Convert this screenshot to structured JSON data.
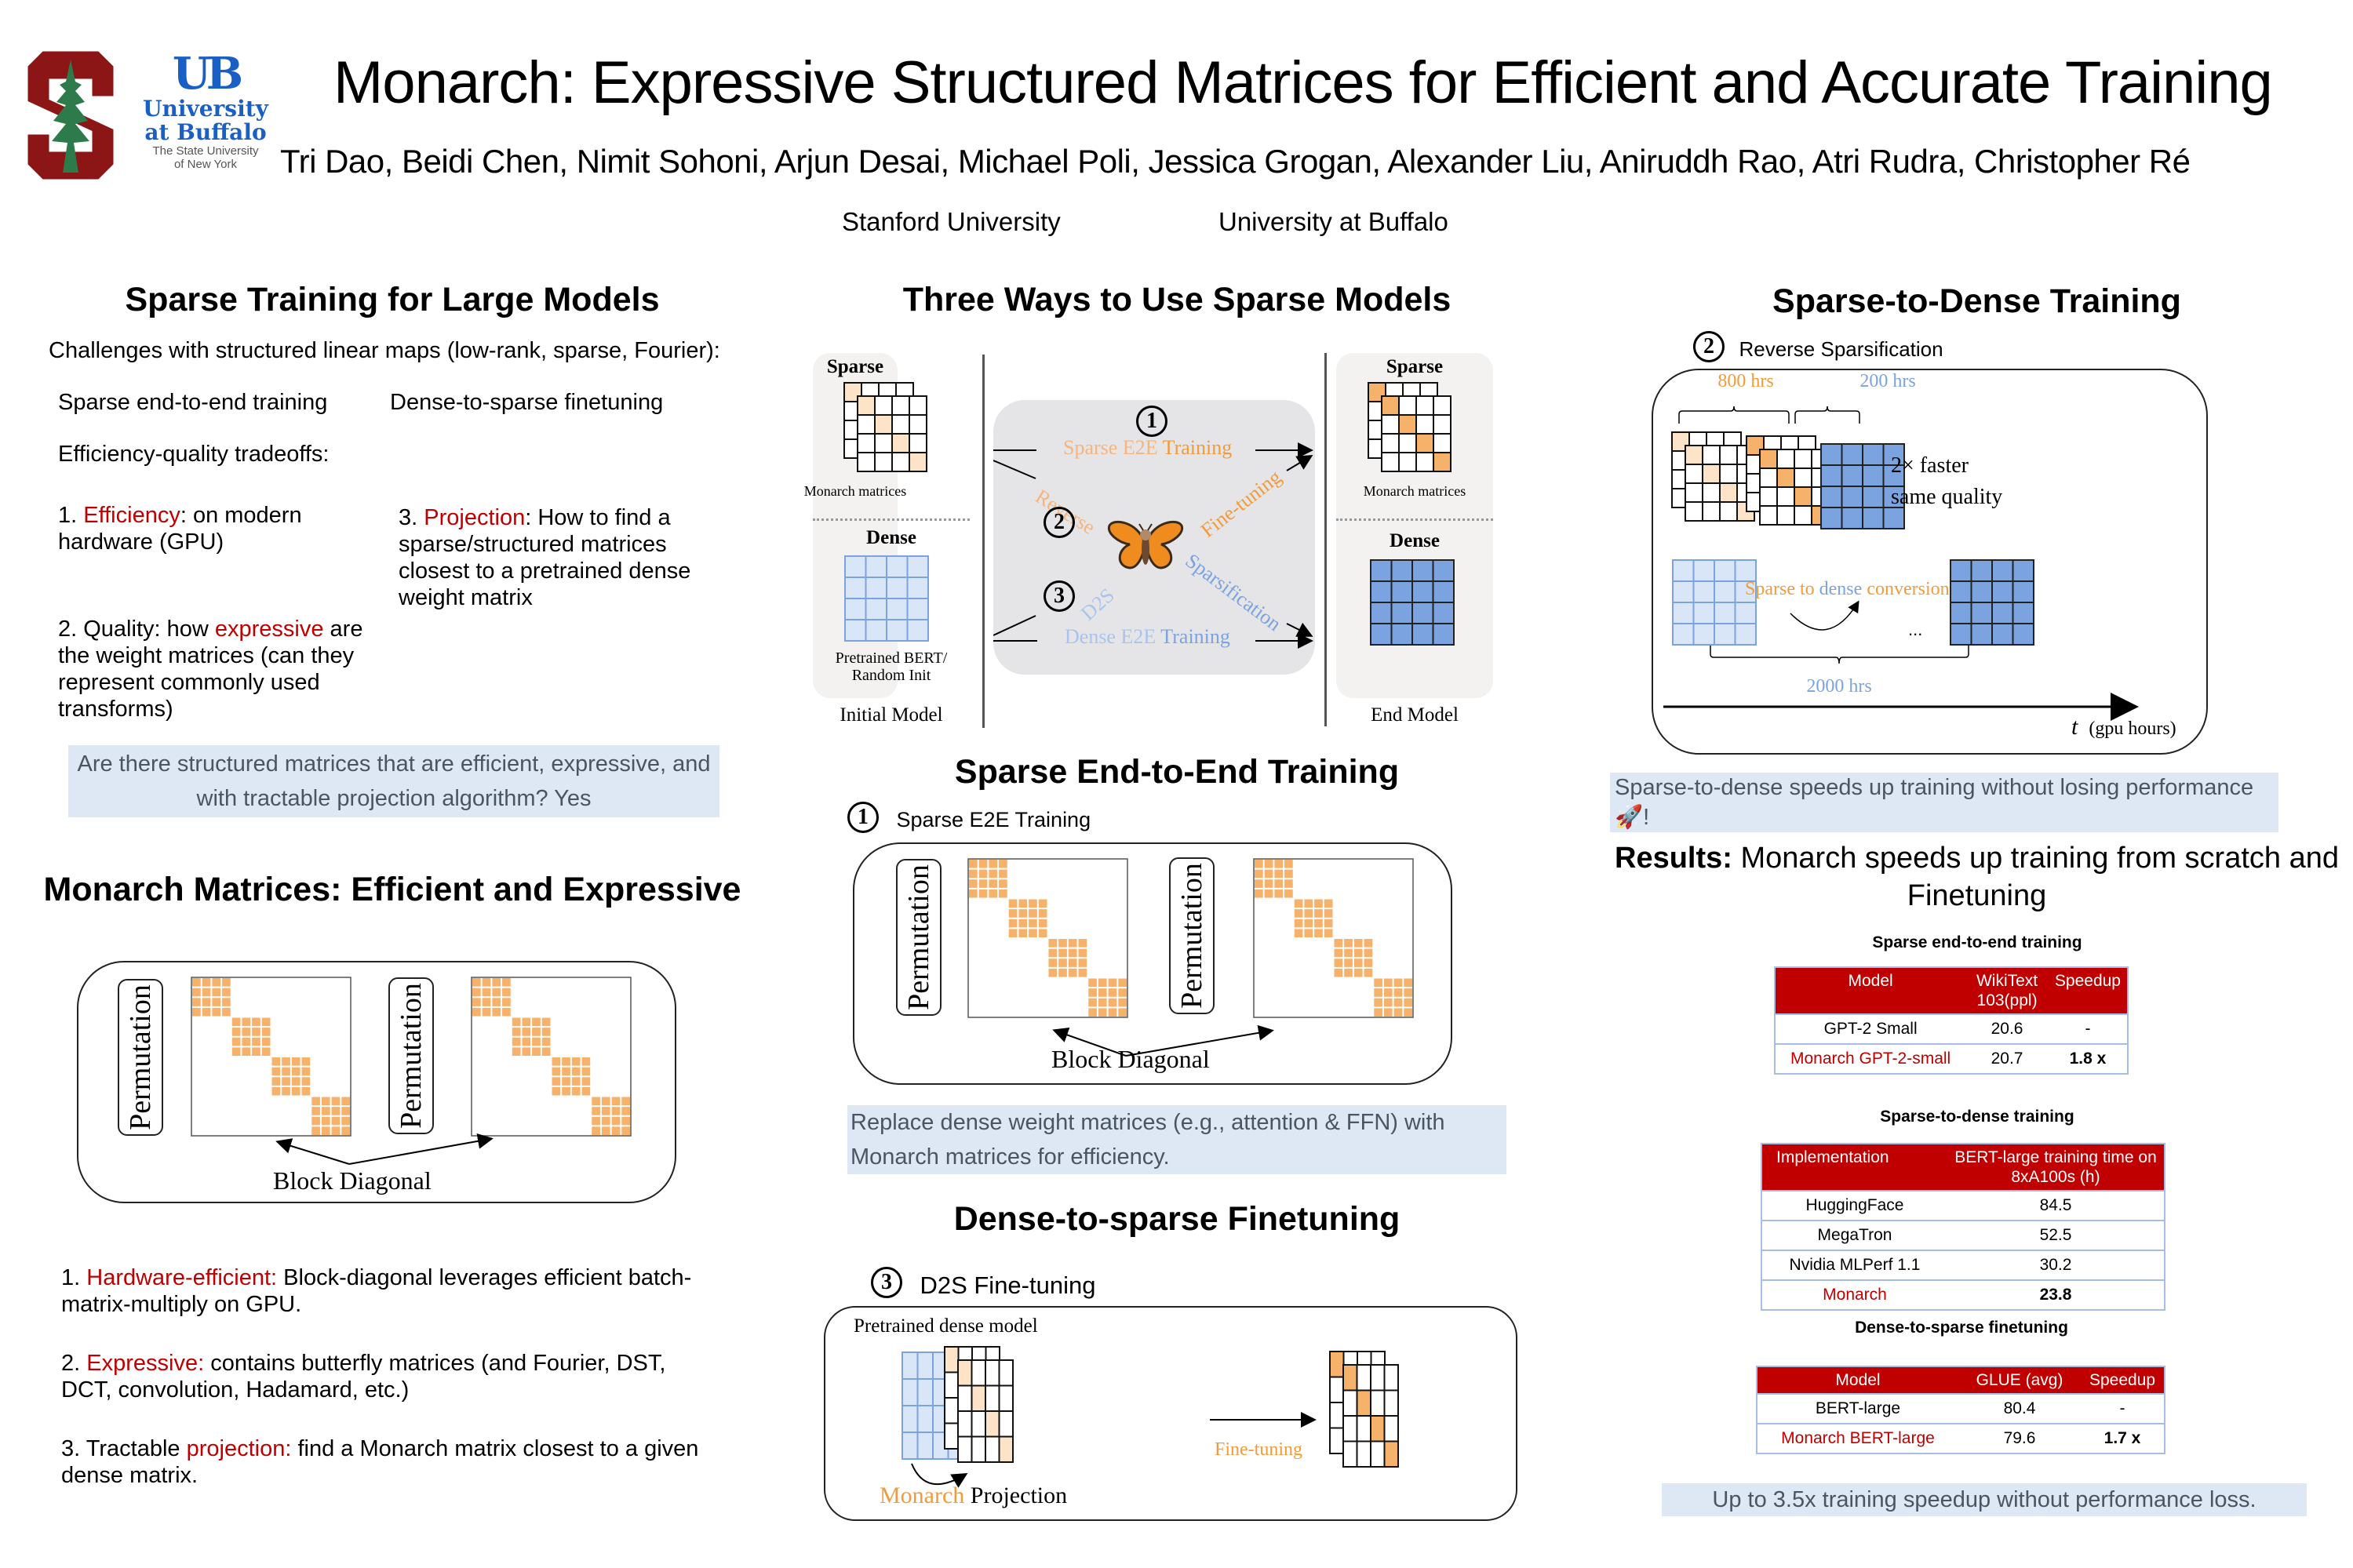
{
  "header": {
    "title": "Monarch: Expressive Structured Matrices for Efficient and Accurate Training",
    "authors": "Tri Dao, Beidi Chen, Nimit Sohoni, Arjun Desai, Michael Poli, Jessica Grogan, Alexander Liu, Aniruddh Rao, Atri Rudra, Christopher Ré",
    "affiliations": [
      "Stanford University",
      "University at Buffalo"
    ],
    "logos": {
      "stanford": "stanford-logo",
      "ub_mark": "UB",
      "ub_name_1": "University",
      "ub_name_2": "at Buffalo",
      "ub_sub_1": "The State University",
      "ub_sub_2": "of New York"
    }
  },
  "colors": {
    "accent_red": "#c00000",
    "orange": "#f29b3b",
    "light_orange": "#fde3c8",
    "blue": "#7aa3e0",
    "light_blue": "#d9e6f8",
    "callout_bg": "#dde8f4"
  },
  "sparse_training": {
    "title": "Sparse Training for Large Models",
    "challenges": "Challenges with structured linear maps (low-rank, sparse, Fourier):",
    "col1": "Sparse end-to-end training",
    "col2": "Dense-to-sparse finetuning",
    "tradeoffs": "Efficiency-quality tradeoffs:",
    "item1_prefix": "1. ",
    "item1_hl": "Efficiency",
    "item1_rest": ": on modern hardware (GPU)",
    "item2_prefix": "2. Quality: how ",
    "item2_hl": "expressive",
    "item2_rest": " are the weight matrices (can they represent commonly used transforms)",
    "item3_prefix": "3. ",
    "item3_hl": "Projection",
    "item3_rest": ": How to find a sparse/structured matrices closest to a pretrained dense weight matrix",
    "callout": "Are there structured matrices that are efficient, expressive, and with tractable projection algorithm? Yes"
  },
  "monarch_matrices": {
    "title": "Monarch Matrices: Efficient and Expressive",
    "permutation": "Permutation",
    "block_diagonal": "Block Diagonal",
    "points": [
      {
        "prefix": "1. ",
        "hl": "Hardware-efficient:",
        "rest": " Block-diagonal leverages efficient batch-matrix-multiply on GPU."
      },
      {
        "prefix": "2. ",
        "hl": "Expressive:",
        "rest": " contains butterfly matrices (and Fourier, DST, DCT, convolution, Hadamard, etc.)"
      },
      {
        "prefix": "3. Tractable ",
        "hl": "projection:",
        "rest": " find a Monarch matrix closest to a given dense matrix."
      }
    ]
  },
  "three_ways": {
    "title": "Three Ways to Use Sparse Models",
    "sparse": "Sparse",
    "dense": "Dense",
    "monarch_matrices": "Monarch matrices",
    "pretrained": "Pretrained BERT/",
    "random_init": "Random Init",
    "initial_model": "Initial Model",
    "end_model": "End Model",
    "num1": "1",
    "num2": "2",
    "num3": "3",
    "sparse_e2e_a": "Sparse E2E ",
    "sparse_e2e_b": "Training",
    "reverse": "Reverse",
    "sparsification": "Sparsification",
    "d2s": "D2S",
    "finetuning": "Fine-tuning",
    "dense_e2e_a": "Dense E2E ",
    "dense_e2e_b": "Training",
    "butterfly_icon": "butterfly-icon"
  },
  "sparse_e2e": {
    "title": "Sparse End-to-End Training",
    "num": "1",
    "subtitle": "Sparse E2E Training",
    "permutation": "Permutation",
    "block_diagonal": "Block Diagonal",
    "callout": "Replace dense weight matrices (e.g., attention & FFN) with Monarch matrices for efficiency."
  },
  "d2s": {
    "title": "Dense-to-sparse Finetuning",
    "num": "3",
    "subtitle": "D2S Fine-tuning",
    "pretrained": "Pretrained dense model",
    "finetuning": "Fine-tuning",
    "projection_a": "Monarch",
    "projection_b": " Projection"
  },
  "s2d": {
    "title": "Sparse-to-Dense Training",
    "num": "2",
    "subtitle": "Reverse Sparsification",
    "hrs800": "800 hrs",
    "hrs200": "200 hrs",
    "hrs2000": "2000 hrs",
    "faster": "2× faster",
    "quality": "same quality",
    "conv_a": "Sparse to ",
    "conv_b": "dense",
    "conv_c": " conversion",
    "ellipsis": "...",
    "axis_t": "t",
    "axis_label": "(gpu hours)",
    "callout": "Sparse-to-dense speeds up training without losing performance 🚀!"
  },
  "results": {
    "title_bold": "Results:",
    "title_rest": " Monarch speeds up training from scratch and Finetuning",
    "table1": {
      "caption": "Sparse end-to-end training",
      "headers": [
        "Model",
        "WikiText 103(ppl)",
        "Speedup"
      ],
      "rows": [
        [
          "GPT-2 Small",
          "20.6",
          "-"
        ],
        [
          "Monarch GPT-2-small",
          "20.7",
          "1.8 x"
        ]
      ]
    },
    "table2": {
      "caption": "Sparse-to-dense training",
      "headers": [
        "Implementation",
        "BERT-large training time on 8xA100s (h)"
      ],
      "rows": [
        [
          "HuggingFace",
          "84.5"
        ],
        [
          "MegaTron",
          "52.5"
        ],
        [
          "Nvidia MLPerf 1.1",
          "30.2"
        ],
        [
          "Monarch",
          "23.8"
        ]
      ]
    },
    "table3": {
      "caption": "Dense-to-sparse finetuning",
      "headers": [
        "Model",
        "GLUE (avg)",
        "Speedup"
      ],
      "rows": [
        [
          "BERT-large",
          "80.4",
          "-"
        ],
        [
          "Monarch BERT-large",
          "79.6",
          "1.7 x"
        ]
      ]
    },
    "callout": "Up to 3.5x training speedup without performance loss."
  }
}
